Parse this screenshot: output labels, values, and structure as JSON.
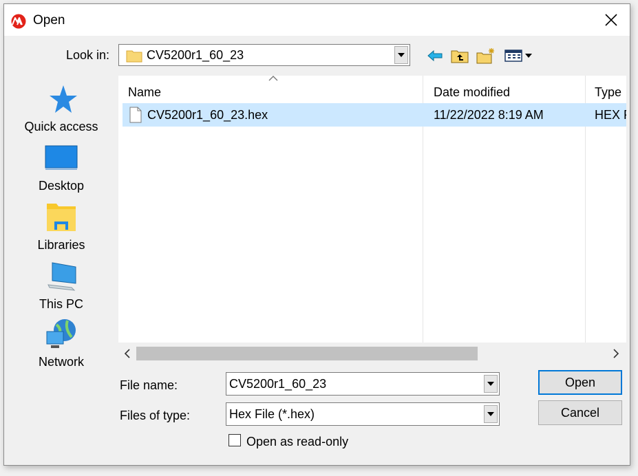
{
  "window": {
    "title": "Open",
    "close_icon": "close-icon",
    "app_icon": "microchip-logo-icon"
  },
  "lookin": {
    "label": "Look in:",
    "value": "CV5200r1_60_23",
    "icon": "folder-icon"
  },
  "toolbar": {
    "back_icon": "back-arrow-icon",
    "up_icon": "up-folder-icon",
    "new_folder_icon": "new-folder-icon",
    "view_menu_icon": "view-menu-icon"
  },
  "places": [
    {
      "label": "Quick access",
      "icon": "star-icon"
    },
    {
      "label": "Desktop",
      "icon": "desktop-icon"
    },
    {
      "label": "Libraries",
      "icon": "libraries-icon"
    },
    {
      "label": "This PC",
      "icon": "computer-icon"
    },
    {
      "label": "Network",
      "icon": "network-icon"
    }
  ],
  "filelist": {
    "columns": [
      "Name",
      "Date modified",
      "Type"
    ],
    "rows": [
      {
        "name": "CV5200r1_60_23.hex",
        "date": "11/22/2022 8:19 AM",
        "type": "HEX F",
        "selected": true
      }
    ]
  },
  "form": {
    "filename_label": "File name:",
    "filename_value": "CV5200r1_60_23",
    "filetype_label": "Files of type:",
    "filetype_value": "Hex File (*.hex)",
    "readonly_label": "Open as read-only",
    "readonly_checked": false
  },
  "buttons": {
    "open": "Open",
    "cancel": "Cancel"
  },
  "colors": {
    "selection": "#cce8ff",
    "accent": "#0078d7"
  }
}
